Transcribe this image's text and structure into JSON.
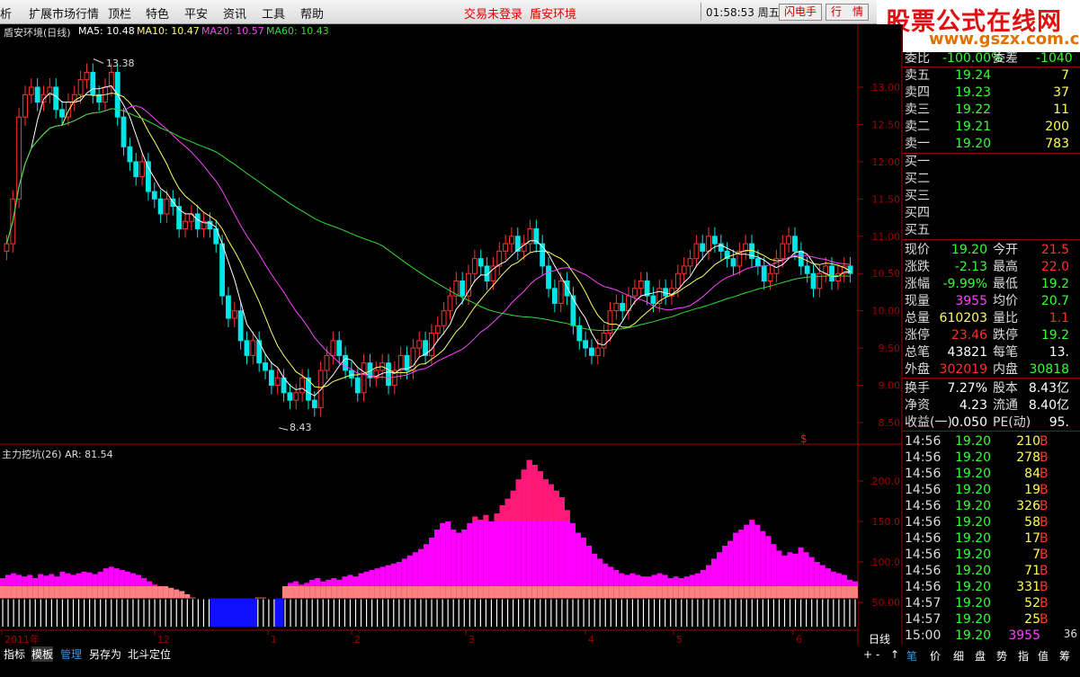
{
  "menu": [
    "析",
    "扩展市场行情",
    "顶栏",
    "特色",
    "平安",
    "资讯",
    "工具",
    "帮助"
  ],
  "status": {
    "trade": "交易未登录",
    "stock": "盾安环境"
  },
  "clock": {
    "time": "01:58:53",
    "weekday": "周五"
  },
  "buttons": {
    "flash": "闪电手",
    "quote": "行　情"
  },
  "logo": {
    "title": "股票公式在线网",
    "url": "www.gszx.com.cn"
  },
  "main_chart": {
    "title": "盾安环境(日线)",
    "ma": [
      {
        "label": "MA5: 10.48",
        "color": "#ffffff"
      },
      {
        "label": "MA10: 10.47",
        "color": "#ffff66"
      },
      {
        "label": "MA20: 10.57",
        "color": "#ff44ff"
      },
      {
        "label": "MA60: 10.43",
        "color": "#33dd33"
      }
    ],
    "high_label": "13.38",
    "low_label": "8.43",
    "yticks": [
      "13.00",
      "12.50",
      "12.00",
      "11.50",
      "11.00",
      "10.50",
      "10.00",
      "9.50",
      "9.00",
      "8.50"
    ],
    "xticks": [
      "2011年",
      "12",
      "1",
      "2",
      "3",
      "4",
      "5",
      "6"
    ],
    "marker": "$"
  },
  "indicator": {
    "title": "主力挖坑(26)",
    "value": "AR: 81.54",
    "yticks": [
      "200.0",
      "150.0",
      "100.0",
      "50.00"
    ]
  },
  "chart_data": {
    "type": "bar",
    "title": "主力挖坑(26)",
    "yticks": [
      "200.0",
      "150.0",
      "100.0",
      "50.00"
    ],
    "values": [
      80,
      84,
      86,
      84,
      82,
      84,
      80,
      85,
      83,
      85,
      82,
      88,
      86,
      84,
      86,
      88,
      87,
      85,
      88,
      92,
      94,
      92,
      90,
      88,
      86,
      84,
      80,
      76,
      72,
      70,
      70,
      68,
      66,
      64,
      60,
      56,
      54,
      52,
      50,
      50,
      50,
      50,
      50,
      50,
      50,
      52,
      54,
      56,
      56,
      54,
      52,
      50,
      70,
      74,
      76,
      72,
      74,
      78,
      80,
      76,
      78,
      80,
      78,
      82,
      84,
      82,
      86,
      88,
      90,
      92,
      94,
      96,
      98,
      100,
      104,
      108,
      112,
      116,
      122,
      130,
      140,
      148,
      150,
      140,
      136,
      140,
      148,
      156,
      152,
      158,
      150,
      160,
      170,
      178,
      188,
      202,
      214,
      226,
      220,
      212,
      202,
      196,
      188,
      180,
      164,
      148,
      136,
      130,
      120,
      110,
      104,
      98,
      94,
      90,
      86,
      84,
      86,
      84,
      82,
      82,
      84,
      86,
      84,
      80,
      82,
      80,
      82,
      84,
      86,
      90,
      96,
      104,
      112,
      120,
      126,
      136,
      140,
      146,
      152,
      146,
      138,
      132,
      122,
      114,
      108,
      112,
      110,
      118,
      112,
      106,
      100,
      96,
      92,
      88,
      86,
      84,
      78,
      76
    ]
  },
  "info_panel": {
    "wb": {
      "label": "委比",
      "value": "-100.00%",
      "label2": "委差",
      "value2": "-1040"
    },
    "asks": [
      {
        "label": "卖五",
        "price": "19.24",
        "vol": "7"
      },
      {
        "label": "卖四",
        "price": "19.23",
        "vol": "37"
      },
      {
        "label": "卖三",
        "price": "19.22",
        "vol": "11"
      },
      {
        "label": "卖二",
        "price": "19.21",
        "vol": "200"
      },
      {
        "label": "卖一",
        "price": "19.20",
        "vol": "783"
      }
    ],
    "bids": [
      "买一",
      "买二",
      "买三",
      "买四",
      "买五"
    ],
    "stats": [
      {
        "l1": "现价",
        "v1": "19.20",
        "c1": "#33ff33",
        "l2": "今开",
        "v2": "21.5",
        "c2": "#ff3030"
      },
      {
        "l1": "涨跌",
        "v1": "-2.13",
        "c1": "#33ff33",
        "l2": "最高",
        "v2": "22.0",
        "c2": "#ff3030"
      },
      {
        "l1": "涨幅",
        "v1": "-9.99%",
        "c1": "#33ff33",
        "l2": "最低",
        "v2": "19.2",
        "c2": "#33ff33"
      },
      {
        "l1": "现量",
        "v1": "3955",
        "c1": "#ff40ff",
        "l2": "均价",
        "v2": "20.7",
        "c2": "#33ff33"
      },
      {
        "l1": "总量",
        "v1": "610203",
        "c1": "#ffff55",
        "l2": "量比",
        "v2": "1.1",
        "c2": "#ff3030"
      },
      {
        "l1": "涨停",
        "v1": "23.46",
        "c1": "#ff3030",
        "l2": "跌停",
        "v2": "19.2",
        "c2": "#33ff33"
      },
      {
        "l1": "总笔",
        "v1": "43821",
        "c1": "#ffffff",
        "l2": "每笔",
        "v2": "13.",
        "c2": "#ffffff"
      },
      {
        "l1": "外盘",
        "v1": "302019",
        "c1": "#ff3030",
        "l2": "内盘",
        "v2": "30818",
        "c2": "#33ff33"
      }
    ],
    "stats2": [
      {
        "l1": "换手",
        "v1": "7.27%",
        "c1": "#ffffff",
        "l2": "股本",
        "v2": "8.43亿",
        "c2": "#ffffff"
      },
      {
        "l1": "净资",
        "v1": "4.23",
        "c1": "#ffffff",
        "l2": "流通",
        "v2": "8.40亿",
        "c2": "#ffffff"
      },
      {
        "l1": "收益(一)",
        "v1": "0.050",
        "c1": "#ffffff",
        "l2": "PE(动)",
        "v2": "95.",
        "c2": "#ffffff"
      }
    ],
    "ticks": [
      {
        "t": "14:56",
        "p": "19.20",
        "v": "210",
        "s": "B"
      },
      {
        "t": "14:56",
        "p": "19.20",
        "v": "278",
        "s": "B"
      },
      {
        "t": "14:56",
        "p": "19.20",
        "v": "84",
        "s": "B"
      },
      {
        "t": "14:56",
        "p": "19.20",
        "v": "19",
        "s": "B"
      },
      {
        "t": "14:56",
        "p": "19.20",
        "v": "326",
        "s": "B"
      },
      {
        "t": "14:56",
        "p": "19.20",
        "v": "58",
        "s": "B"
      },
      {
        "t": "14:56",
        "p": "19.20",
        "v": "17",
        "s": "B"
      },
      {
        "t": "14:56",
        "p": "19.20",
        "v": "7",
        "s": "B"
      },
      {
        "t": "14:56",
        "p": "19.20",
        "v": "71",
        "s": "B"
      },
      {
        "t": "14:56",
        "p": "19.20",
        "v": "331",
        "s": "B"
      },
      {
        "t": "14:57",
        "p": "19.20",
        "v": "52",
        "s": "B"
      },
      {
        "t": "14:57",
        "p": "19.20",
        "v": "25",
        "s": "B"
      },
      {
        "t": "15:00",
        "p": "19.20",
        "v": "3955",
        "s": ""
      }
    ],
    "tick_extra": "36"
  },
  "bottom_tabs": [
    "指标",
    "模板",
    "管理",
    "另存为",
    "北斗定位"
  ],
  "period": "日线",
  "right_tabs": [
    "+",
    "-",
    "↑",
    "笔",
    "价",
    "细",
    "盘",
    "势",
    "指",
    "值",
    "筹"
  ]
}
